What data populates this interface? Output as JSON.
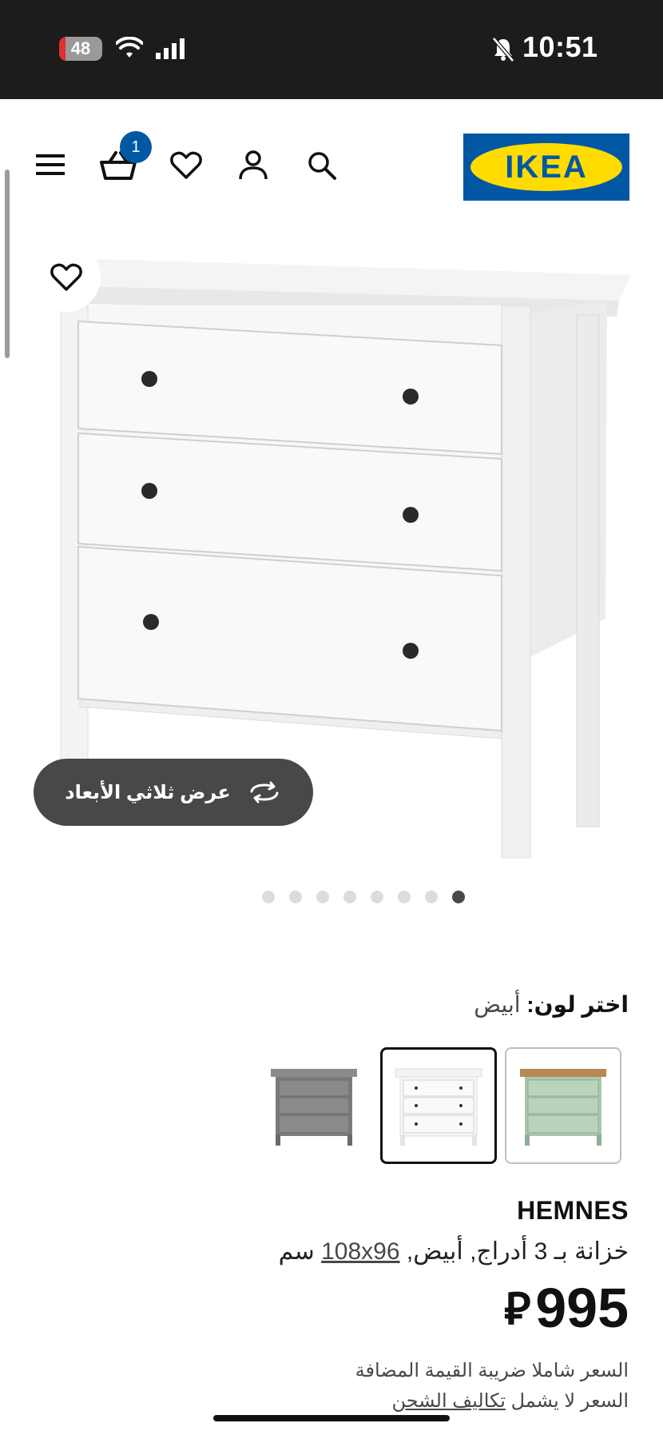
{
  "status_bar": {
    "battery": "48",
    "time": "10:51"
  },
  "header": {
    "logo_text": "IKEA",
    "cart_count": "1",
    "icons": [
      "menu-icon",
      "cart-icon",
      "heart-icon",
      "user-icon",
      "search-icon"
    ]
  },
  "gallery": {
    "view_3d_label": "عرض ثلاثي الأبعاد",
    "dot_count": 8,
    "active_dot": 8
  },
  "color_picker": {
    "label": "اختر لون:",
    "selected_value": "أبيض",
    "swatches": [
      "green-gray",
      "white",
      "gray"
    ],
    "selected_swatch": "white"
  },
  "product": {
    "name": "HEMNES",
    "description": "خزانة بـ 3 أدراج, أبيض,",
    "dimensions": "108x96",
    "unit": "سم",
    "price": "995",
    "currency": "⃁",
    "vat_note": "السعر شاملا ضريبة القيمة المضافة",
    "shipping_prefix": "السعر لا يشمل",
    "shipping_link": "تكاليف الشحن"
  },
  "colors": {
    "ikea_blue": "#0058a3",
    "ikea_yellow": "#ffdb00",
    "dark_pill": "#484848"
  }
}
